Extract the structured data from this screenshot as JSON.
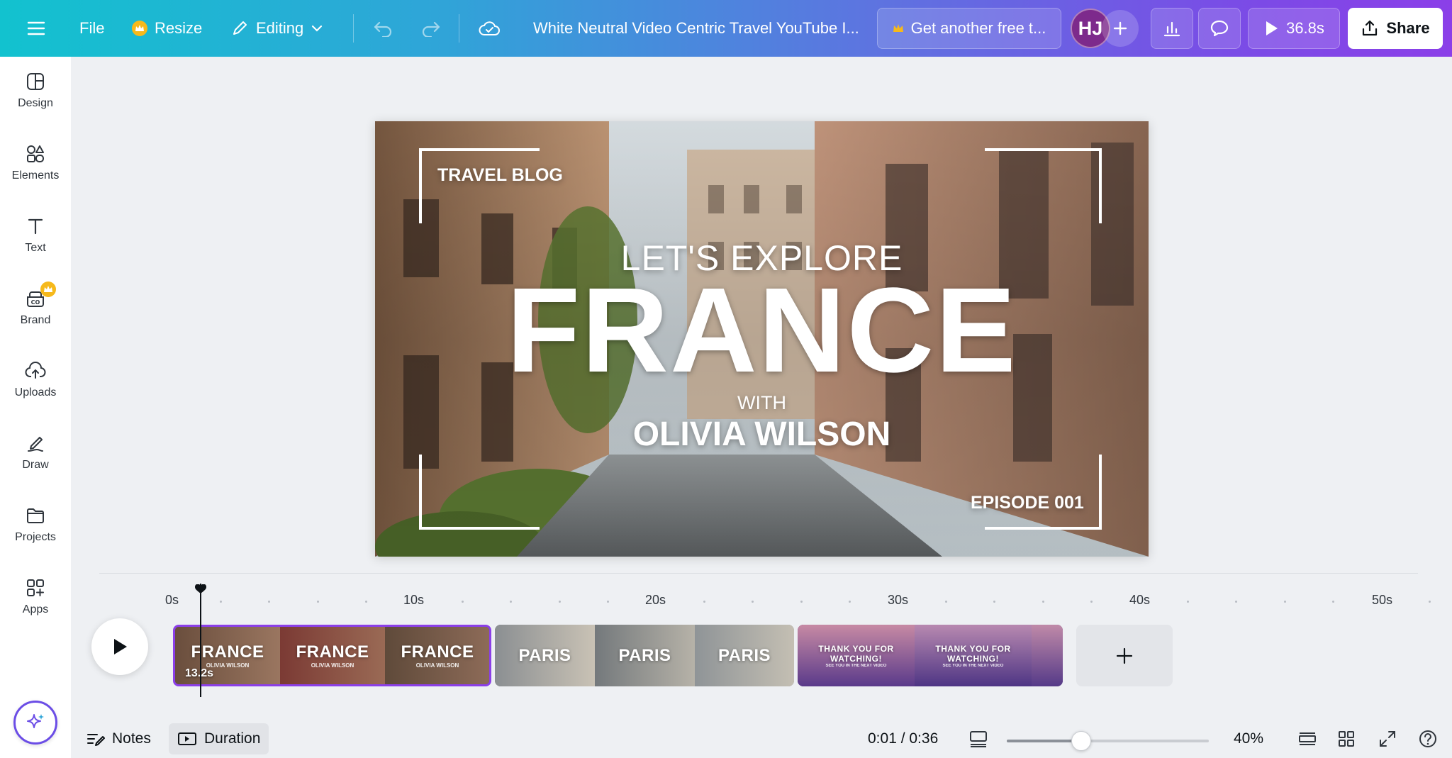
{
  "topbar": {
    "file_label": "File",
    "resize_label": "Resize",
    "editing_label": "Editing",
    "doc_title": "White Neutral Video Centric Travel YouTube I...",
    "free_trial_label": "Get another free t...",
    "avatar_initials": "HJ",
    "play_duration": "36.8s",
    "share_label": "Share"
  },
  "sidebar": {
    "items": [
      {
        "label": "Design",
        "icon": "design-icon"
      },
      {
        "label": "Elements",
        "icon": "elements-icon"
      },
      {
        "label": "Text",
        "icon": "text-icon"
      },
      {
        "label": "Brand",
        "icon": "brand-icon"
      },
      {
        "label": "Uploads",
        "icon": "uploads-icon"
      },
      {
        "label": "Draw",
        "icon": "draw-icon"
      },
      {
        "label": "Projects",
        "icon": "projects-icon"
      },
      {
        "label": "Apps",
        "icon": "apps-icon"
      }
    ]
  },
  "canvas": {
    "travel_blog": "TRAVEL BLOG",
    "lets_explore": "LET'S EXPLORE",
    "headline": "FRANCE",
    "with": "WITH",
    "host": "OLIVIA WILSON",
    "episode": "EPISODE 001"
  },
  "timeline": {
    "ruler": [
      "0s",
      "10s",
      "20s",
      "30s",
      "40s",
      "50s"
    ],
    "clips": [
      {
        "title": "FRANCE",
        "subtitle": "OLIVIA WILSON",
        "duration": "13.2s",
        "selected": true
      },
      {
        "title": "PARIS",
        "subtitle": "",
        "selected": false
      },
      {
        "title": "THANK YOU FOR WATCHING!",
        "subtitle": "SEE YOU IN THE NEXT VIDEO",
        "selected": false
      }
    ]
  },
  "bottombar": {
    "notes_label": "Notes",
    "duration_label": "Duration",
    "time": "0:01 / 0:36",
    "zoom": "40%",
    "zoom_level": 0.37
  },
  "colors": {
    "accent": "#8b3fe8",
    "teal": "#12c2cf",
    "selected_clip": "#8b3fe8"
  }
}
